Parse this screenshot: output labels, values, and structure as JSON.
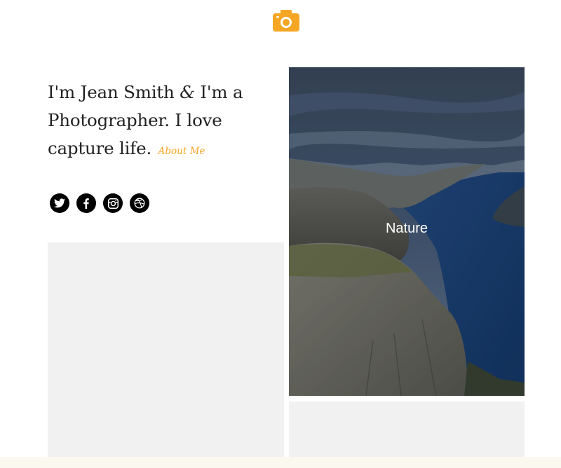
{
  "colors": {
    "accent": "#f5a623",
    "text": "#222222",
    "tile_gray": "#f1f1f1",
    "icon_bg": "#000000"
  },
  "header": {
    "logo_icon": "camera-icon"
  },
  "intro": {
    "line_start": "I'm Jean Smith ",
    "amp": "&",
    "line_end": " I'm a Photographer. I love capture life.",
    "about_link": "About Me"
  },
  "social": [
    {
      "icon": "twitter-icon"
    },
    {
      "icon": "facebook-icon"
    },
    {
      "icon": "instagram-icon"
    },
    {
      "icon": "dribbble-icon"
    }
  ],
  "gallery": {
    "featured_label": "Nature"
  }
}
